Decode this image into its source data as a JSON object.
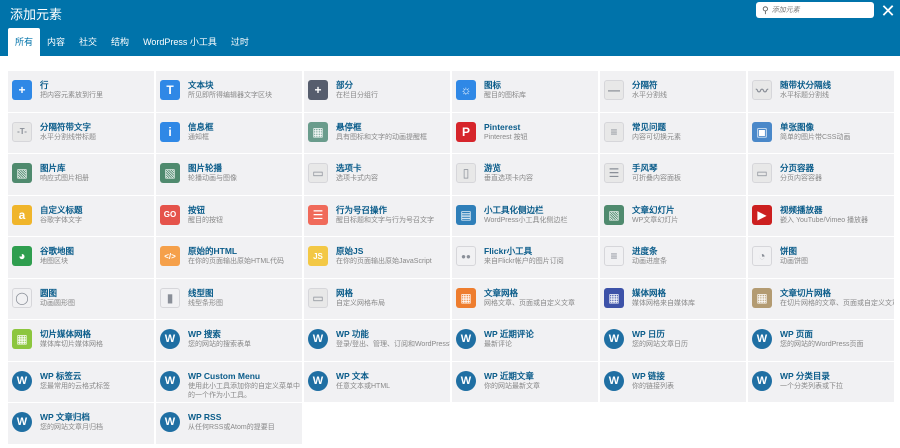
{
  "header": {
    "title": "添加元素",
    "search_placeholder": "添加元素",
    "close_glyph": "✕",
    "search_glyph": "⚲"
  },
  "tabs": [
    {
      "label": "所有",
      "active": true
    },
    {
      "label": "内容",
      "active": false
    },
    {
      "label": "社交",
      "active": false
    },
    {
      "label": "结构",
      "active": false
    },
    {
      "label": "WordPress 小工具",
      "active": false
    },
    {
      "label": "过时",
      "active": false
    }
  ],
  "items": [
    {
      "name": "行",
      "desc": "把内容元素放到行里",
      "icon": "plus-icon",
      "glyph": "+",
      "color": "#2f88e6"
    },
    {
      "name": "文本块",
      "desc": "所见即所得编辑器文字区块",
      "icon": "text-icon",
      "glyph": "T",
      "color": "#2f88e6"
    },
    {
      "name": "部分",
      "desc": "在栏目分组行",
      "icon": "section-icon",
      "glyph": "+",
      "color": "#565d6d"
    },
    {
      "name": "图标",
      "desc": "醒目的图标库",
      "icon": "sun-icon",
      "glyph": "☼",
      "color": "#2f88e6"
    },
    {
      "name": "分隔符",
      "desc": "水平分割线",
      "icon": "separator-icon",
      "glyph": "—",
      "color": "#e8e8e8"
    },
    {
      "name": "随带状分隔线",
      "desc": "水平标题分割线",
      "icon": "zigzag-icon",
      "glyph": "〰",
      "color": "#e8e8e8"
    },
    {
      "name": "分隔符带文字",
      "desc": "水平分割线带标题",
      "icon": "text-separator-icon",
      "glyph": "-T-",
      "color": "#e8e8e8"
    },
    {
      "name": "信息框",
      "desc": "通知框",
      "icon": "info-icon",
      "glyph": "i",
      "color": "#2f88e6"
    },
    {
      "name": "悬停框",
      "desc": "具有图标和文字的动画提醒框",
      "icon": "hoverbox-icon",
      "glyph": "▦",
      "color": "#6a9c8c"
    },
    {
      "name": "Pinterest",
      "desc": "Pinterest 按钮",
      "icon": "pinterest-icon",
      "glyph": "P",
      "color": "#d6252b"
    },
    {
      "name": "常见问题",
      "desc": "内容可切换元素",
      "icon": "faq-icon",
      "glyph": "≡",
      "color": "#e8e8e8"
    },
    {
      "name": "单张图像",
      "desc": "简单的图片带CSS动画",
      "icon": "single-image-icon",
      "glyph": "▣",
      "color": "#4a88c9"
    },
    {
      "name": "图片库",
      "desc": "响应式图片相册",
      "icon": "gallery-icon",
      "glyph": "▧",
      "color": "#4f8a6e"
    },
    {
      "name": "图片轮播",
      "desc": "轮播动画与图像",
      "icon": "carousel-icon",
      "glyph": "▧",
      "color": "#4f8a6e"
    },
    {
      "name": "选项卡",
      "desc": "选项卡式内容",
      "icon": "tabs-icon",
      "glyph": "▭",
      "color": "#e8e8e8"
    },
    {
      "name": "游览",
      "desc": "垂直选项卡内容",
      "icon": "tour-icon",
      "glyph": "▯",
      "color": "#e8e8e8"
    },
    {
      "name": "手风琴",
      "desc": "可折叠内容面板",
      "icon": "accordion-icon",
      "glyph": "☰",
      "color": "#e8e8e8"
    },
    {
      "name": "分页容器",
      "desc": "分页内容容器",
      "icon": "pageable-icon",
      "glyph": "▭",
      "color": "#e8e8e8"
    },
    {
      "name": "自定义标题",
      "desc": "谷歌字体文字",
      "icon": "heading-icon",
      "glyph": "a",
      "color": "#f0b52b"
    },
    {
      "name": "按钮",
      "desc": "醒目的按钮",
      "icon": "button-icon",
      "glyph": "GO",
      "color": "#e5534b"
    },
    {
      "name": "行为号召操作",
      "desc": "醒目标题和文字与行为号召文字",
      "icon": "cta-icon",
      "glyph": "☰",
      "color": "#f06a5a"
    },
    {
      "name": "小工具化侧边栏",
      "desc": "WordPress小工具化侧边栏",
      "icon": "sidebar-icon",
      "glyph": "▤",
      "color": "#2f7fb9"
    },
    {
      "name": "文章幻灯片",
      "desc": "WP文章幻灯片",
      "icon": "post-slider-icon",
      "glyph": "▧",
      "color": "#4f8a6e"
    },
    {
      "name": "视频播放器",
      "desc": "嵌入 YouTube/Vimeo 播放器",
      "icon": "video-icon",
      "glyph": "▶",
      "color": "#cc1f1f"
    },
    {
      "name": "谷歌地图",
      "desc": "地图区块",
      "icon": "map-icon",
      "glyph": "◕",
      "color": "#2f9e4f"
    },
    {
      "name": "原始的HTML",
      "desc": "在你的页面输出原始HTML代码",
      "icon": "html-icon",
      "glyph": "</>",
      "color": "#f5a04a"
    },
    {
      "name": "原始JS",
      "desc": "在你的页面输出原始JavaScript",
      "icon": "js-icon",
      "glyph": "JS",
      "color": "#f3c845"
    },
    {
      "name": "Flickr小工具",
      "desc": "来自Flickr帐户的图片订阅",
      "icon": "flickr-icon",
      "glyph": "●●",
      "color": "#f1f1f3"
    },
    {
      "name": "进度条",
      "desc": "动画进度条",
      "icon": "progress-icon",
      "glyph": "≡",
      "color": "#f1f1f3"
    },
    {
      "name": "饼图",
      "desc": "动画饼图",
      "icon": "pie-icon",
      "glyph": "◔",
      "color": "#f1f1f3"
    },
    {
      "name": "圆图",
      "desc": "动画圆形图",
      "icon": "round-chart-icon",
      "glyph": "◯",
      "color": "#f1f1f3"
    },
    {
      "name": "线型图",
      "desc": "线型条形图",
      "icon": "line-chart-icon",
      "glyph": "▮",
      "color": "#f1f1f3"
    },
    {
      "name": "网格",
      "desc": "自定义网格布局",
      "icon": "grid-icon",
      "glyph": "▭",
      "color": "#e8e8e8"
    },
    {
      "name": "文章网格",
      "desc": "网格文章、页面或自定义文章",
      "icon": "post-grid-icon",
      "glyph": "▦",
      "color": "#ee7d2e"
    },
    {
      "name": "媒体网格",
      "desc": "媒体网格来自媒体库",
      "icon": "media-grid-icon",
      "glyph": "▦",
      "color": "#3d52a8"
    },
    {
      "name": "文章切片网格",
      "desc": "在切片网格的文章、页面或自定义文章",
      "icon": "masonry-icon",
      "glyph": "▦",
      "color": "#b39b72"
    },
    {
      "name": "切片媒体网格",
      "desc": "媒体库切片媒体网格",
      "icon": "masonry-media-icon",
      "glyph": "▦",
      "color": "#8cc63e"
    },
    {
      "name": "WP 搜索",
      "desc": "您的网站的搜索表单",
      "icon": "wordpress-icon",
      "glyph": "W",
      "color": "#1f6fa3"
    },
    {
      "name": "WP 功能",
      "desc": "登录/登出、管理、订阅和WordPress链接",
      "icon": "wordpress-icon",
      "glyph": "W",
      "color": "#1f6fa3"
    },
    {
      "name": "WP 近期评论",
      "desc": "最新评论",
      "icon": "wordpress-icon",
      "glyph": "W",
      "color": "#1f6fa3"
    },
    {
      "name": "WP 日历",
      "desc": "您的网站文章日历",
      "icon": "wordpress-icon",
      "glyph": "W",
      "color": "#1f6fa3"
    },
    {
      "name": "WP 页面",
      "desc": "您的网站的WordPress页面",
      "icon": "wordpress-icon",
      "glyph": "W",
      "color": "#1f6fa3"
    },
    {
      "name": "WP 标签云",
      "desc": "您最常用的云格式标签",
      "icon": "wordpress-icon",
      "glyph": "W",
      "color": "#1f6fa3"
    },
    {
      "name": "WP Custom Menu",
      "desc": "使用此小工具添加你的自定义菜单中的一个作为小工具。",
      "icon": "wordpress-icon",
      "glyph": "W",
      "color": "#1f6fa3",
      "wrap": true
    },
    {
      "name": "WP 文本",
      "desc": "任意文本或HTML",
      "icon": "wordpress-icon",
      "glyph": "W",
      "color": "#1f6fa3"
    },
    {
      "name": "WP 近期文章",
      "desc": "你的网站最新文章",
      "icon": "wordpress-icon",
      "glyph": "W",
      "color": "#1f6fa3"
    },
    {
      "name": "WP 链接",
      "desc": "你的链接列表",
      "icon": "wordpress-icon",
      "glyph": "W",
      "color": "#1f6fa3"
    },
    {
      "name": "WP 分类目录",
      "desc": "一个分类列表或下拉",
      "icon": "wordpress-icon",
      "glyph": "W",
      "color": "#1f6fa3"
    },
    {
      "name": "WP 文章归档",
      "desc": "您的网站文章月归档",
      "icon": "wordpress-icon",
      "glyph": "W",
      "color": "#1f6fa3"
    },
    {
      "name": "WP RSS",
      "desc": "从任何RSS或Atom的提要目",
      "icon": "wordpress-icon",
      "glyph": "W",
      "color": "#1f6fa3"
    }
  ]
}
